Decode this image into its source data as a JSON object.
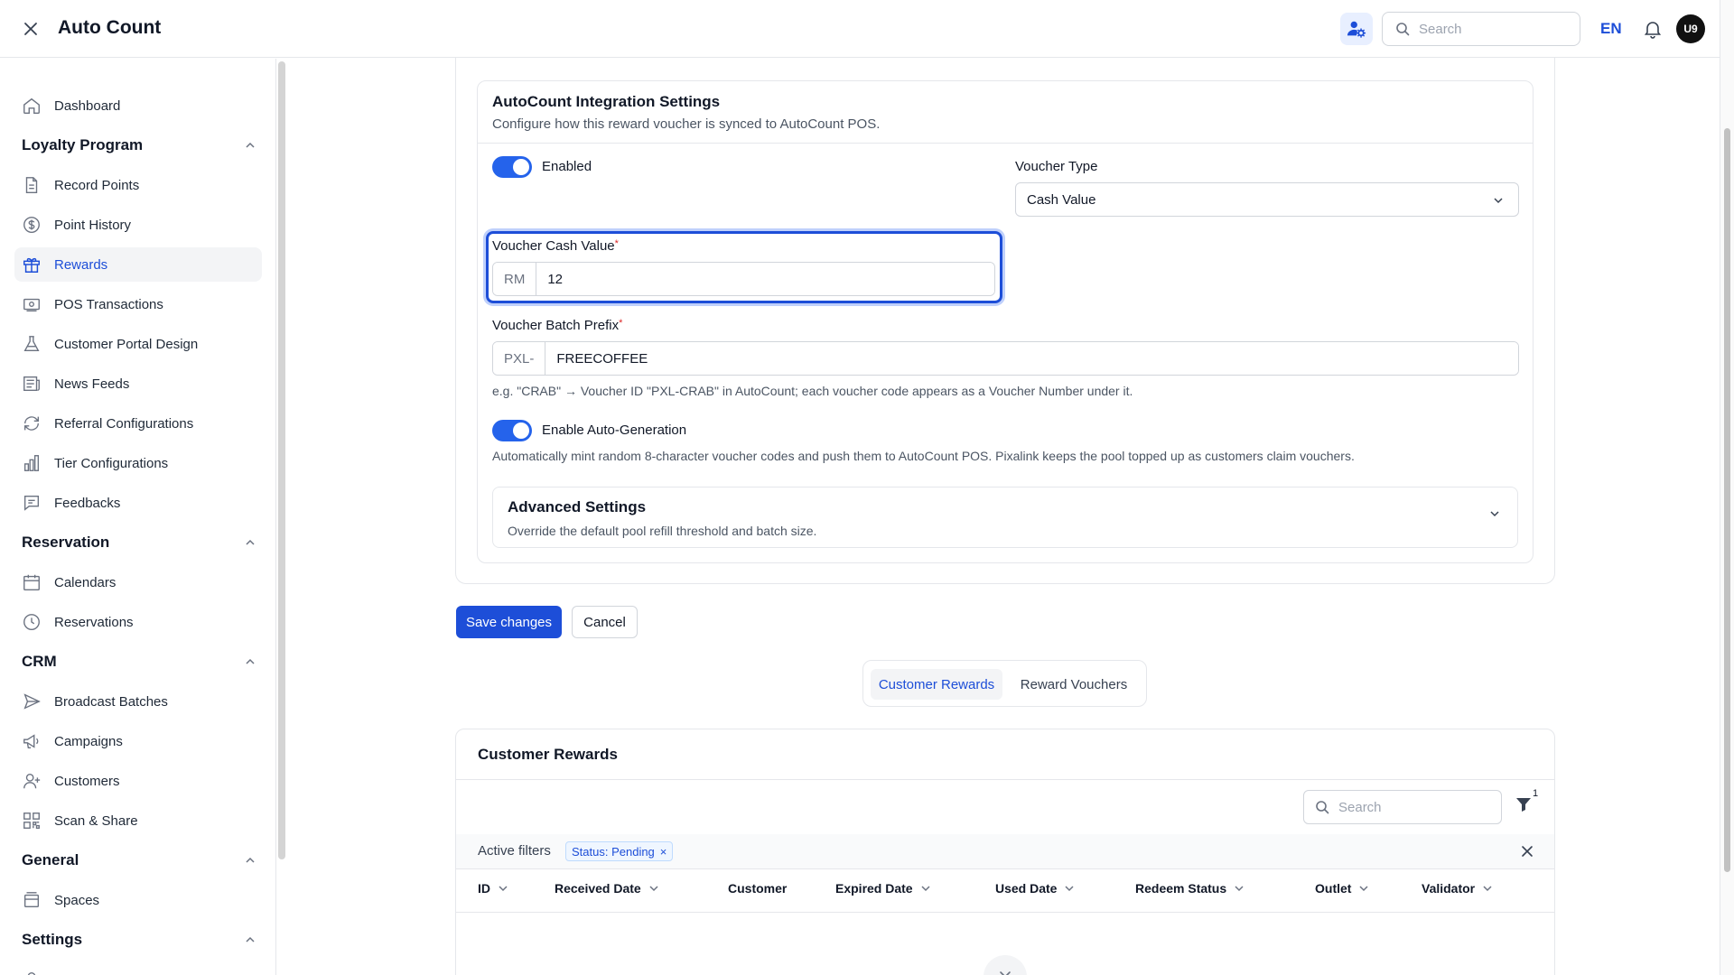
{
  "app": {
    "title": "Auto Count"
  },
  "topbar": {
    "search_placeholder": "Search",
    "language": "EN",
    "avatar_initials": "U9"
  },
  "sidebar": {
    "dashboard": "Dashboard",
    "groups": {
      "loyalty": "Loyalty Program",
      "reservation": "Reservation",
      "crm": "CRM",
      "general": "General",
      "settings": "Settings"
    },
    "items": {
      "record_points": "Record Points",
      "point_history": "Point History",
      "rewards": "Rewards",
      "pos_transactions": "POS Transactions",
      "customer_portal_design": "Customer Portal Design",
      "news_feeds": "News Feeds",
      "referral_configurations": "Referral Configurations",
      "tier_configurations": "Tier Configurations",
      "feedbacks": "Feedbacks",
      "calendars": "Calendars",
      "reservations": "Reservations",
      "broadcast_batches": "Broadcast Batches",
      "campaigns": "Campaigns",
      "customers": "Customers",
      "scan_share": "Scan & Share",
      "spaces": "Spaces"
    },
    "active": "Rewards"
  },
  "integration": {
    "title": "AutoCount Integration Settings",
    "subtitle": "Configure how this reward voucher is synced to AutoCount POS.",
    "enabled_label": "Enabled",
    "enabled": true,
    "voucher_type_label": "Voucher Type",
    "voucher_type_value": "Cash Value",
    "cash_value_label": "Voucher Cash Value",
    "required_mark": "*",
    "cash_prefix": "RM",
    "cash_value": "12",
    "batch_prefix_label": "Voucher Batch Prefix",
    "batch_prefix_addon": "PXL-",
    "batch_prefix_value": "FREECOFFEE",
    "batch_prefix_hint": "e.g. \"CRAB\" → Voucher ID \"PXL-CRAB\" in AutoCount; each voucher code appears as a Voucher Number under it.",
    "auto_gen_label": "Enable Auto-Generation",
    "auto_gen_enabled": true,
    "auto_gen_hint": "Automatically mint random 8-character voucher codes and push them to AutoCount POS. Pixalink keeps the pool topped up as customers claim vouchers.",
    "advanced_title": "Advanced Settings",
    "advanced_subtitle": "Override the default pool refill threshold and batch size."
  },
  "actions": {
    "save": "Save changes",
    "cancel": "Cancel"
  },
  "tabs": {
    "customer_rewards": "Customer Rewards",
    "reward_vouchers": "Reward Vouchers",
    "active": "Customer Rewards"
  },
  "table": {
    "title": "Customer Rewards",
    "search_placeholder": "Search",
    "filter_count": "1",
    "active_filters_label": "Active filters",
    "chip_label": "Status: Pending",
    "chip_remove": "×",
    "columns": [
      "ID",
      "Received Date",
      "Customer",
      "Expired Date",
      "Used Date",
      "Redeem Status",
      "Outlet",
      "Validator"
    ]
  },
  "colors": {
    "accent": "#1d4ed8",
    "toggle_on": "#2563eb",
    "required": "#dc2626"
  }
}
